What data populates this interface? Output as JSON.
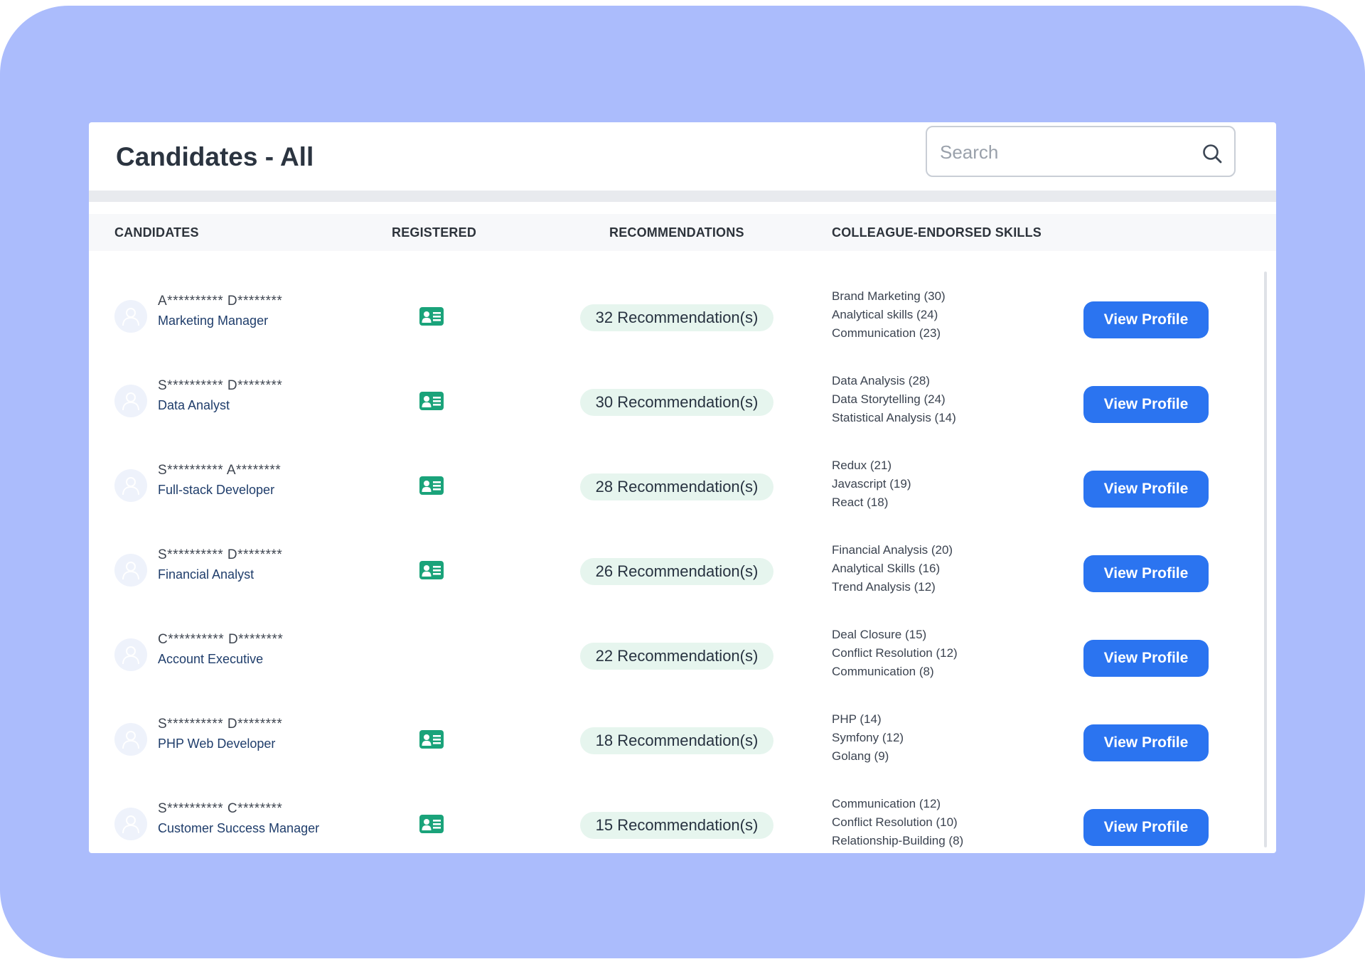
{
  "page": {
    "title": "Candidates - All",
    "search": {
      "placeholder": "Search",
      "value": ""
    }
  },
  "table": {
    "headers": {
      "candidates": "CANDIDATES",
      "registered": "REGISTERED",
      "recommendations": "RECOMMENDATIONS",
      "skills": "COLLEAGUE-ENDORSED SKILLS"
    },
    "rows": [
      {
        "name": "A********** D********",
        "role": "Marketing Manager",
        "registered": true,
        "recommendations": "32 Recommendation(s)",
        "skills": [
          "Brand Marketing (30)",
          "Analytical skills (24)",
          "Communication (23)"
        ],
        "button": "View Profile"
      },
      {
        "name": "S********** D********",
        "role": "Data Analyst",
        "registered": true,
        "recommendations": "30 Recommendation(s)",
        "skills": [
          "Data Analysis (28)",
          "Data Storytelling (24)",
          "Statistical Analysis (14)"
        ],
        "button": "View Profile"
      },
      {
        "name": "S********** A********",
        "role": "Full-stack Developer",
        "registered": true,
        "recommendations": "28 Recommendation(s)",
        "skills": [
          "Redux (21)",
          "Javascript (19)",
          "React (18)"
        ],
        "button": "View Profile"
      },
      {
        "name": "S********** D********",
        "role": "Financial Analyst",
        "registered": true,
        "recommendations": "26 Recommendation(s)",
        "skills": [
          "Financial Analysis (20)",
          "Analytical Skills (16)",
          "Trend Analysis (12)"
        ],
        "button": "View Profile"
      },
      {
        "name": "C********** D********",
        "role": "Account Executive",
        "registered": false,
        "recommendations": "22 Recommendation(s)",
        "skills": [
          "Deal Closure (15)",
          "Conflict Resolution (12)",
          "Communication (8)"
        ],
        "button": "View Profile"
      },
      {
        "name": "S********** D********",
        "role": "PHP Web Developer",
        "registered": true,
        "recommendations": "18 Recommendation(s)",
        "skills": [
          "PHP (14)",
          "Symfony (12)",
          "Golang (9)"
        ],
        "button": "View Profile"
      },
      {
        "name": "S********** C********",
        "role": "Customer Success Manager",
        "registered": true,
        "recommendations": "15 Recommendation(s)",
        "skills": [
          "Communication (12)",
          "Conflict Resolution (10)",
          "Relationship-Building (8)"
        ],
        "button": "View Profile"
      }
    ]
  },
  "icons": {
    "search": "search-icon",
    "avatar": "user-icon",
    "registered": "id-card-icon"
  },
  "colors": {
    "background_frame": "#abbcfc",
    "primary_button": "#2b74f0",
    "registered_icon": "#1aa37a",
    "recommendation_badge": "#e6f5ee",
    "role_text": "#1f3d6b"
  }
}
